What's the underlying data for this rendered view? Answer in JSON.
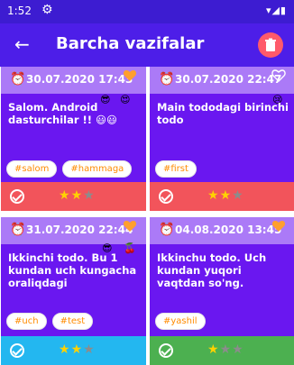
{
  "status_bar": {
    "time": "1:52"
  },
  "app_bar": {
    "title": "Barcha vazifalar"
  },
  "cards": [
    {
      "date": "30.07.2020 17:43",
      "text": "Salom. Android dasturchilar !! 😃😃",
      "tags": [
        "#salom",
        "#hammaga"
      ],
      "rating": 2,
      "footer_color": "#f2545b"
    },
    {
      "date": "30.07.2020 22:47",
      "text": "Main tododagi birinchi todo",
      "tags": [
        "#first"
      ],
      "rating": 2,
      "footer_color": "#f2545b"
    },
    {
      "date": "31.07.2020 22:44",
      "text": "Ikkinchi todo. Bu 1 kundan uch kungacha oraliqdagi",
      "tags": [
        "#uch",
        "#test"
      ],
      "rating": 2,
      "footer_color": "#23b7f0"
    },
    {
      "date": "04.08.2020 13:45",
      "text": "Ikkinchu todo. Uch kundan yuqori vaqtdan so'ng.",
      "tags": [
        "#yashil"
      ],
      "rating": 1,
      "footer_color": "#4cb050"
    }
  ],
  "colors": {
    "status_bar": "#3d1cd1",
    "app_bar": "#4d1ee8",
    "card_header": "#ab7af7",
    "card_body": "#6a17f0",
    "tag_text": "#ff8b00",
    "star_on": "#ffd200",
    "star_off": "#8c8c8c"
  },
  "icons": {
    "back": "arrow-left-icon",
    "trash": "trash-icon",
    "alarm": "alarm-clock-icon",
    "check": "check-circle-icon",
    "star": "star-icon",
    "heart": "heart-icon"
  }
}
